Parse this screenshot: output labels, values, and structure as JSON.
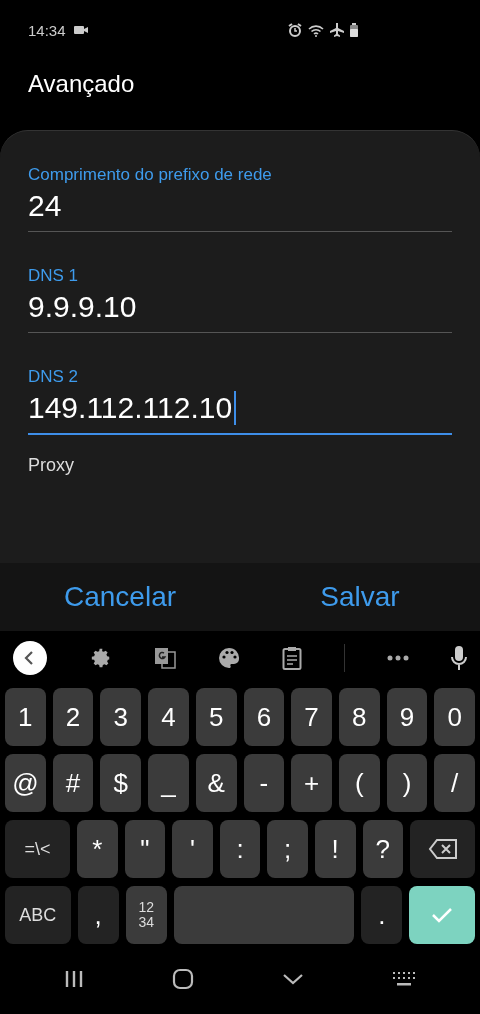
{
  "status_bar": {
    "time": "14:34"
  },
  "title": "Avançado",
  "fields": [
    {
      "label": "Comprimento do prefixo de rede",
      "value": "24",
      "focused": false
    },
    {
      "label": "DNS 1",
      "value": "9.9.9.10",
      "focused": false
    },
    {
      "label": "DNS 2",
      "value": "149.112.112.10",
      "focused": true
    }
  ],
  "proxy_label": "Proxy",
  "buttons": [
    "Cancelar",
    "Salvar"
  ],
  "keyboard": {
    "rows": [
      [
        {
          "kind": "char",
          "label": "1"
        },
        {
          "kind": "char",
          "label": "2"
        },
        {
          "kind": "char",
          "label": "3"
        },
        {
          "kind": "char",
          "label": "4"
        },
        {
          "kind": "char",
          "label": "5"
        },
        {
          "kind": "char",
          "label": "6"
        },
        {
          "kind": "char",
          "label": "7"
        },
        {
          "kind": "char",
          "label": "8"
        },
        {
          "kind": "char",
          "label": "9"
        },
        {
          "kind": "char",
          "label": "0"
        }
      ],
      [
        {
          "kind": "char",
          "label": "@"
        },
        {
          "kind": "char",
          "label": "#"
        },
        {
          "kind": "char",
          "label": "$"
        },
        {
          "kind": "char",
          "label": "_"
        },
        {
          "kind": "char",
          "label": "&"
        },
        {
          "kind": "char",
          "label": "-"
        },
        {
          "kind": "char",
          "label": "+"
        },
        {
          "kind": "char",
          "label": "("
        },
        {
          "kind": "char",
          "label": ")"
        },
        {
          "kind": "char",
          "label": "/"
        }
      ],
      [
        {
          "kind": "mod",
          "label": "=\\<"
        },
        {
          "kind": "char",
          "label": "*"
        },
        {
          "kind": "char",
          "label": "\""
        },
        {
          "kind": "char",
          "label": "'"
        },
        {
          "kind": "char",
          "label": ":"
        },
        {
          "kind": "char",
          "label": ";"
        },
        {
          "kind": "char",
          "label": "!"
        },
        {
          "kind": "char",
          "label": "?"
        },
        {
          "kind": "backspace"
        }
      ],
      [
        {
          "kind": "mod",
          "label": "ABC"
        },
        {
          "kind": "darkchar",
          "label": ","
        },
        {
          "kind": "stack",
          "lines": [
            "12",
            "34"
          ]
        },
        {
          "kind": "space"
        },
        {
          "kind": "darkchar",
          "label": "."
        },
        {
          "kind": "enter"
        }
      ]
    ]
  }
}
